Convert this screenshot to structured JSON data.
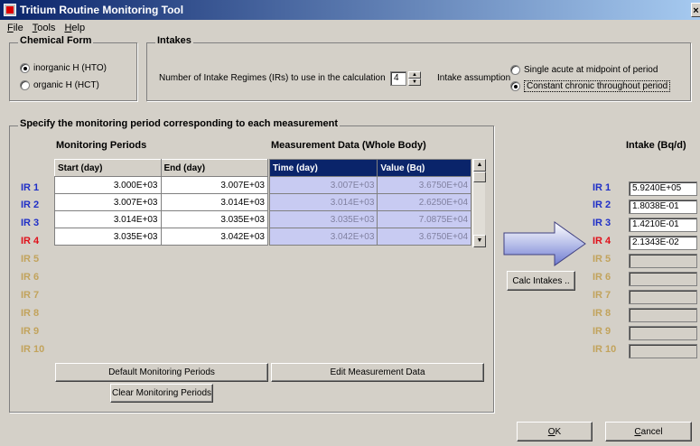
{
  "window": {
    "title": "Tritium Routine Monitoring Tool",
    "close_glyph": "×"
  },
  "menu": [
    "File",
    "Tools",
    "Help"
  ],
  "chemical_form": {
    "legend": "Chemical Form",
    "options": [
      {
        "label": "inorganic H (HTO)",
        "selected": true
      },
      {
        "label": "organic H (HCT)",
        "selected": false
      }
    ]
  },
  "intakes": {
    "legend": "Intakes",
    "regimes_label": "Number of Intake Regimes (IRs) to use in the calculation",
    "regimes_value": "4",
    "assumption_label": "Intake assumption",
    "assumption_options": [
      {
        "label": "Single acute at midpoint of period",
        "selected": false
      },
      {
        "label": "Constant chronic throughout period",
        "selected": true
      }
    ]
  },
  "monitoring": {
    "legend": "Specify the monitoring period corresponding to each measurement",
    "periods_header": "Monitoring Periods",
    "measurement_header": "Measurement Data (Whole Body)",
    "columns": [
      "Start (day)",
      "End (day)",
      "Time (day)",
      "Value (Bq)"
    ],
    "rows": [
      [
        "3.000E+03",
        "3.007E+03",
        "3.007E+03",
        "3.6750E+04"
      ],
      [
        "3.007E+03",
        "3.014E+03",
        "3.014E+03",
        "2.6250E+04"
      ],
      [
        "3.014E+03",
        "3.035E+03",
        "3.035E+03",
        "7.0875E+04"
      ],
      [
        "3.035E+03",
        "3.042E+03",
        "3.042E+03",
        "3.6750E+04"
      ]
    ],
    "ir_labels": [
      "IR 1",
      "IR 2",
      "IR 3",
      "IR 4",
      "IR 5",
      "IR 6",
      "IR 7",
      "IR 8",
      "IR 9",
      "IR 10"
    ],
    "default_button": "Default Monitoring Periods",
    "edit_button": "Edit Measurement Data",
    "clear_button": "Clear Monitoring Periods"
  },
  "results": {
    "header": "Intake (Bq/d)",
    "calc_button": "Calc Intakes ..",
    "ir_labels": [
      "IR 1",
      "IR 2",
      "IR 3",
      "IR 4",
      "IR 5",
      "IR 6",
      "IR 7",
      "IR 8",
      "IR 9",
      "IR 10"
    ],
    "values": [
      "5.9240E+05",
      "1.8038E-01",
      "1.4210E-01",
      "2.1343E-02",
      "",
      "",
      "",
      "",
      "",
      ""
    ]
  },
  "buttons": {
    "ok": "OK",
    "cancel": "Cancel"
  },
  "colors": {
    "ir_active": "#1f2fc7",
    "ir_current": "#e0101a",
    "ir_inactive": "#c2a35c",
    "selection": "#0a246a"
  }
}
